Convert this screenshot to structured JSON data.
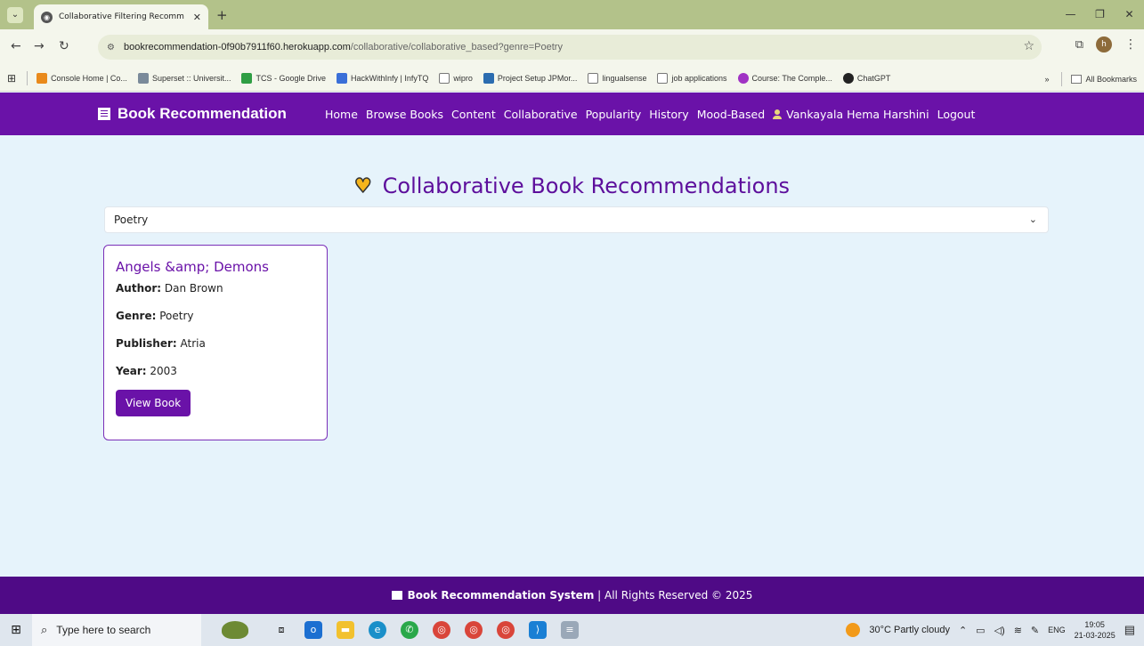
{
  "browser": {
    "tab_title": "Collaborative Filtering Recomm",
    "url_domain": "bookrecommendation-0f90b7911f60.herokuapp.com",
    "url_path": "/collaborative/collaborative_based?genre=Poetry",
    "bookmarks": [
      {
        "label": "Console Home | Co...",
        "color": "#e98a1c"
      },
      {
        "label": "Superset :: Universit...",
        "color": "#7a8a9a"
      },
      {
        "label": "TCS - Google Drive",
        "color": "#2f9e44"
      },
      {
        "label": "HackWithInfy | InfyTQ",
        "color": "#3a6fd8"
      },
      {
        "label": "wipro",
        "color": "#777777"
      },
      {
        "label": "Project Setup JPMor...",
        "color": "#2b6cb0"
      },
      {
        "label": "lingualsense",
        "color": "#777777"
      },
      {
        "label": "job applications",
        "color": "#777777"
      },
      {
        "label": "Course: The Comple...",
        "color": "#a033c4"
      },
      {
        "label": "ChatGPT",
        "color": "#222222"
      }
    ],
    "more_bookmarks": "»",
    "all_bookmarks": "All Bookmarks"
  },
  "navbar": {
    "brand": "Book Recommendation",
    "links": [
      "Home",
      "Browse Books",
      "Content",
      "Collaborative",
      "Popularity",
      "History",
      "Mood-Based"
    ],
    "user": "Vankayala Hema Harshini",
    "logout": "Logout"
  },
  "main": {
    "title": "Collaborative Book Recommendations",
    "selected_genre": "Poetry"
  },
  "book": {
    "title": "Angels &amp; Demons",
    "author_label": "Author:",
    "author": "Dan Brown",
    "genre_label": "Genre:",
    "genre": "Poetry",
    "publisher_label": "Publisher:",
    "publisher": "Atria",
    "year_label": "Year:",
    "year": "2003",
    "button": "View Book"
  },
  "footer": {
    "brand": "Book Recommendation System",
    "rights": " | All Rights Reserved © 2025"
  },
  "taskbar": {
    "search_placeholder": "Type here to search",
    "weather": "30°C  Partly cloudy",
    "lang": "ENG",
    "time": "19:05",
    "date": "21-03-2025"
  },
  "colors": {
    "navbar": "#6a12a8",
    "footer": "#4f0a86",
    "page_bg": "#e6f3fb"
  }
}
